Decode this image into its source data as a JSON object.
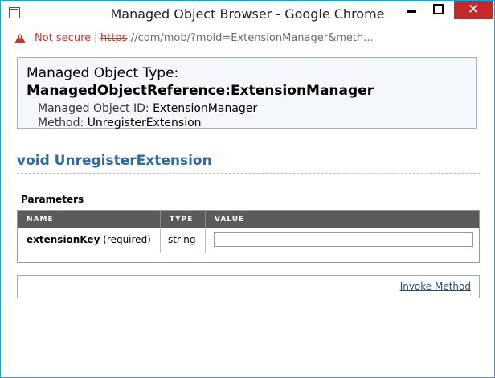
{
  "window": {
    "title": "Managed Object Browser - Google Chrome",
    "close_glyph": "✕"
  },
  "addressbar": {
    "security_text": "Not secure",
    "separator": "|",
    "url_scheme": "https",
    "url_rest": "://com/mob/?moid=ExtensionManager&meth..."
  },
  "managed_object": {
    "type_label": "Managed Object Type:",
    "type_value": "ManagedObjectReference:ExtensionManager",
    "id_label": "Managed Object ID:",
    "id_value": "ExtensionManager",
    "method_label": "Method:",
    "method_value": "UnregisterExtension"
  },
  "method": {
    "signature": "void UnregisterExtension"
  },
  "parameters": {
    "label": "Parameters",
    "columns": [
      "NAME",
      "TYPE",
      "VALUE"
    ],
    "rows": [
      {
        "name": "extensionKey",
        "qualifier": "(required)",
        "type": "string",
        "value": ""
      }
    ]
  },
  "actions": {
    "invoke_label": "Invoke Method"
  }
}
